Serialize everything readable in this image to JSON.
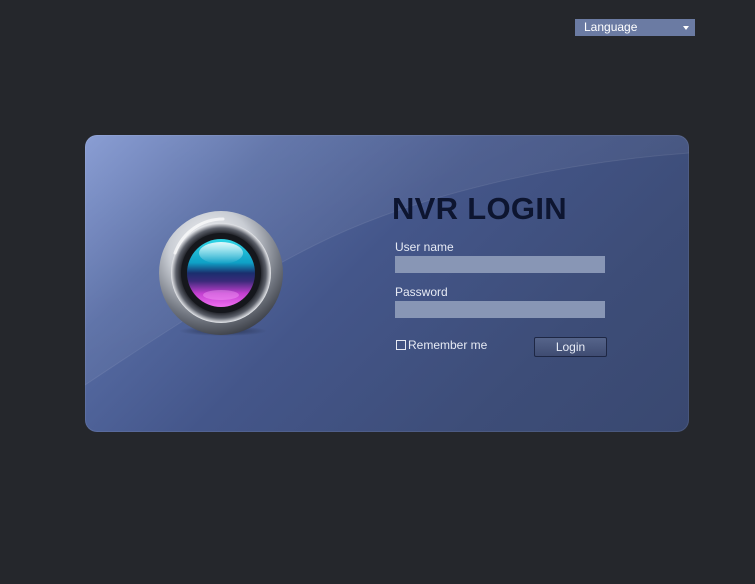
{
  "header": {
    "language_label": "Language"
  },
  "login": {
    "title": "NVR LOGIN",
    "username_label": "User name",
    "username_value": "",
    "password_label": "Password",
    "password_value": "",
    "remember_label": "Remember me",
    "remember_checked": false,
    "login_button_label": "Login"
  },
  "icons": {
    "logo": "camera-lens-orb-icon",
    "dropdown": "caret-down-icon"
  },
  "colors": {
    "background": "#25272c",
    "language_select": "#6b7ba3",
    "panel_light": "#7d93cf",
    "panel_dark": "#394870",
    "title": "#0d1530",
    "input": "#8896b5",
    "button": "#4a5880"
  }
}
